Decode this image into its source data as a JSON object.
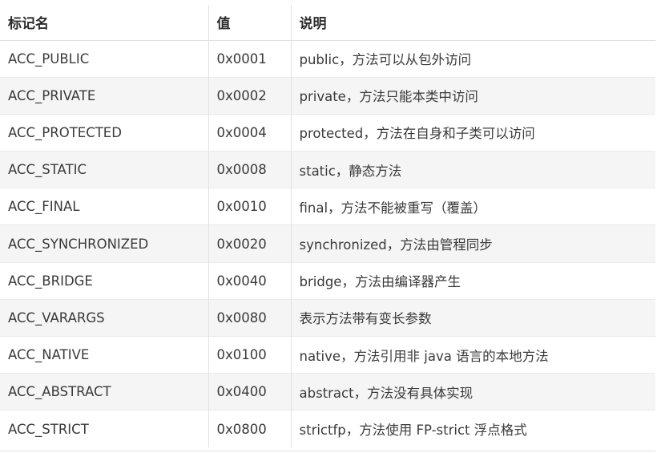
{
  "table": {
    "headers": [
      "标记名",
      "值",
      "说明"
    ],
    "rows": [
      [
        "ACC_PUBLIC",
        "0x0001",
        "public，方法可以从包外访问"
      ],
      [
        "ACC_PRIVATE",
        "0x0002",
        "private，方法只能本类中访问"
      ],
      [
        "ACC_PROTECTED",
        "0x0004",
        "protected，方法在自身和子类可以访问"
      ],
      [
        "ACC_STATIC",
        "0x0008",
        "static，静态方法"
      ],
      [
        "ACC_FINAL",
        "0x0010",
        "final，方法不能被重写（覆盖）"
      ],
      [
        "ACC_SYNCHRONIZED",
        "0x0020",
        "synchronized，方法由管程同步"
      ],
      [
        "ACC_BRIDGE",
        "0x0040",
        "bridge，方法由编译器产生"
      ],
      [
        "ACC_VARARGS",
        "0x0080",
        "表示方法带有变长参数"
      ],
      [
        "ACC_NATIVE",
        "0x0100",
        "native，方法引用非 java 语言的本地方法"
      ],
      [
        "ACC_ABSTRACT",
        "0x0400",
        "abstract，方法没有具体实现"
      ],
      [
        "ACC_STRICT",
        "0x0800",
        "strictfp，方法使用 FP-strict 浮点格式"
      ]
    ]
  }
}
